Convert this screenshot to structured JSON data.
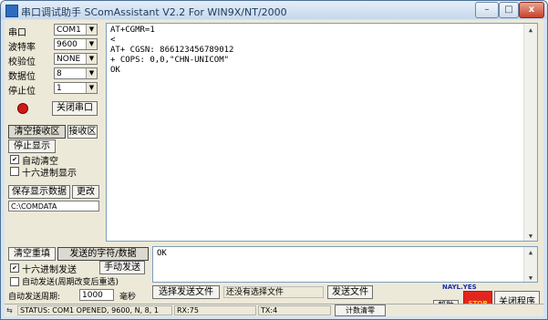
{
  "window": {
    "title": "串口调试助手 SComAssistant V2.2 For WIN9X/NT/2000",
    "minimize": "–",
    "maximize": "□",
    "close": "x"
  },
  "settings": {
    "port_label": "串口",
    "port_value": "COM1",
    "baud_label": "波特率",
    "baud_value": "9600",
    "parity_label": "校验位",
    "parity_value": "NONE",
    "databits_label": "数据位",
    "databits_value": "8",
    "stopbits_label": "停止位",
    "stopbits_value": "1",
    "close_port": "关闭串口"
  },
  "receive": {
    "clear_button": "清空接收区",
    "receive_area": "接收区",
    "stop_display": "停止显示",
    "auto_clear": "自动清空",
    "hex_display": "十六进制显示",
    "save_button": "保存显示数据",
    "change_button": "更改",
    "save_path": "C:\\COMDATA",
    "lines": [
      "AT+CGMR=1",
      "<",
      "AT+ CGSN: 866123456789012",
      "",
      "",
      "+ COPS: 0,0,\"CHN-UNICOM\"",
      "OK"
    ]
  },
  "send": {
    "clear_button": "清空重填",
    "send_area": "发送的字符/数据",
    "hex_send": "十六进制发送",
    "manual_send": "手动发送",
    "auto_send": "自动发送(周期改变后重选)",
    "period_label": "自动发送周期:",
    "period_value": "1000",
    "ms_label": "毫秒",
    "select_file": "选择发送文件",
    "file_status": "还没有选择文件",
    "send_file": "发送文件",
    "input_text": "OK"
  },
  "footer": {
    "help": "帮助",
    "brand": "NAYL.YES",
    "close_program": "关闭程序",
    "stop_label": "STOP"
  },
  "statusbar": {
    "status": "STATUS: COM1 OPENED, 9600, N, 8, 1",
    "rx": "RX:75",
    "tx": "TX:4",
    "reset_count": "计数清零"
  }
}
